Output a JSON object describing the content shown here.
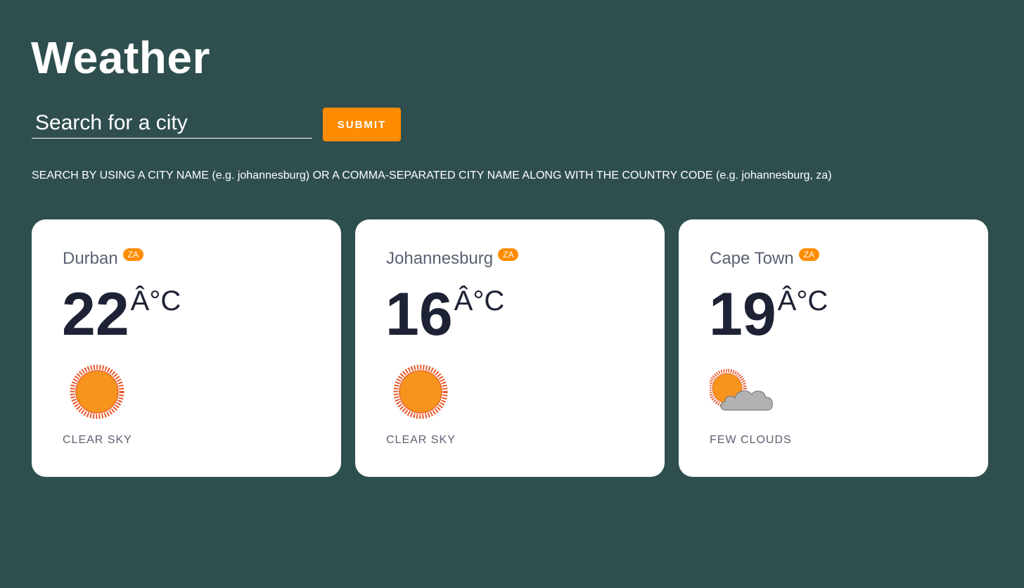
{
  "header": {
    "title": "Weather"
  },
  "search": {
    "placeholder": "Search for a city",
    "value": "",
    "submit_label": "SUBMIT"
  },
  "hint": "SEARCH BY USING A CITY NAME (e.g. johannesburg) OR A COMMA-SEPARATED CITY NAME ALONG WITH THE COUNTRY CODE (e.g. johannesburg, za)",
  "colors": {
    "background": "#2f4f4f",
    "accent": "#ff8c00",
    "card": "#ffffff"
  },
  "cards": [
    {
      "city": "Durban",
      "country": "ZA",
      "temp": "22",
      "unit": "Â°C",
      "icon": "sun-icon",
      "condition": "CLEAR SKY"
    },
    {
      "city": "Johannesburg",
      "country": "ZA",
      "temp": "16",
      "unit": "Â°C",
      "icon": "sun-icon",
      "condition": "CLEAR SKY"
    },
    {
      "city": "Cape Town",
      "country": "ZA",
      "temp": "19",
      "unit": "Â°C",
      "icon": "sun-cloud-icon",
      "condition": "FEW CLOUDS"
    }
  ]
}
